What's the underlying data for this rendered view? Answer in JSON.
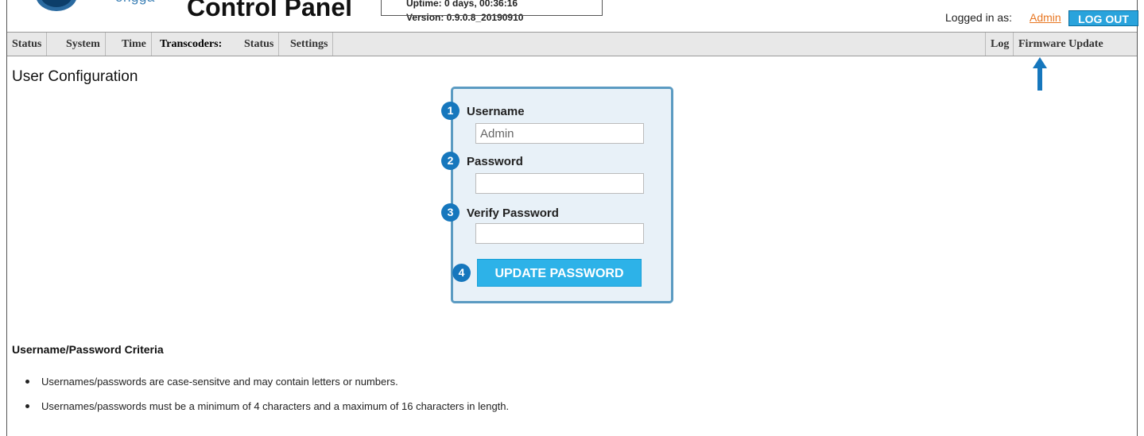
{
  "header": {
    "logo_text": "ongga",
    "title": "Control Panel",
    "uptime": "Uptime: 0 days, 00:36:16",
    "version": "Version: 0.9.0.8_20190910",
    "logged_in_label": "Logged in as:",
    "user_link": "Admin",
    "logout_label": "LOG OUT"
  },
  "nav": {
    "left": [
      "Status",
      "System",
      "Time",
      "Transcoders:",
      "Status",
      "Settings"
    ],
    "right": [
      "Log",
      "Firmware Update"
    ]
  },
  "page": {
    "title": "User Configuration"
  },
  "form": {
    "badges": [
      "1",
      "2",
      "3",
      "4"
    ],
    "username_label": "Username",
    "username_value": "Admin",
    "password_label": "Password",
    "verify_label": "Verify Password",
    "submit_label": "UPDATE PASSWORD"
  },
  "criteria": {
    "title": "Username/Password Criteria",
    "items": [
      "Usernames/passwords are case-sensitve and may contain letters or numbers.",
      "Usernames/passwords must be a minimum of 4 characters and a maximum of 16 characters in length."
    ]
  },
  "colors": {
    "accent_blue": "#29a3dc",
    "badge_blue": "#1677bd",
    "link_orange": "#e87722",
    "panel_bg": "#e8f1f8"
  }
}
